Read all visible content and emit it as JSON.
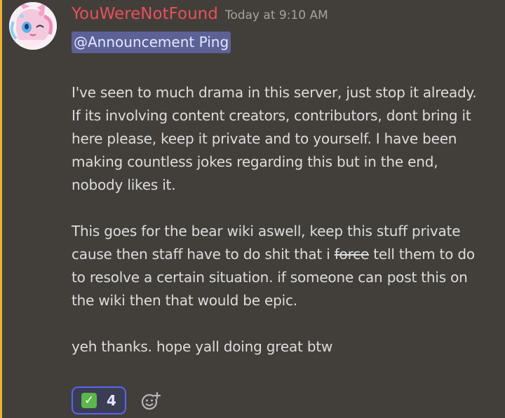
{
  "message": {
    "author": {
      "name": "YouWereNotFound",
      "avatar_icon": "avatar-icon",
      "name_color": "#e8505b"
    },
    "timestamp": "Today at 9:10 AM",
    "mention": "@Announcement Ping",
    "paragraphs": [
      {
        "lines": [
          "I've seen to much drama in this server, just stop it already.",
          "If its involving content creators, contributors, dont bring it",
          "here please, keep it private and to yourself. I have been",
          "making countless jokes regarding this but in the end,",
          "nobody likes it."
        ]
      },
      {
        "lines": [
          "This goes for the bear wiki aswell, keep this stuff private"
        ],
        "line2_before": "cause then staff have to do shit that i ",
        "line2_strike": "force",
        "line2_after": " tell them to do",
        "lines_rest": [
          "to resolve a certain situation. if someone can post this on",
          "the wiki then that would be epic."
        ]
      },
      {
        "lines": [
          "yeh thanks. hope yall doing great btw"
        ]
      }
    ],
    "reactions": [
      {
        "emoji_icon": "white-check-mark-icon",
        "count": "4",
        "active": true
      }
    ],
    "add_reaction_icon": "add-reaction-icon"
  },
  "colors": {
    "background": "#423f3a",
    "highlight_bar": "#f0b232",
    "mention_bg": "#5c6296",
    "reaction_border": "#5865f2",
    "check_green": "#5ab748"
  }
}
